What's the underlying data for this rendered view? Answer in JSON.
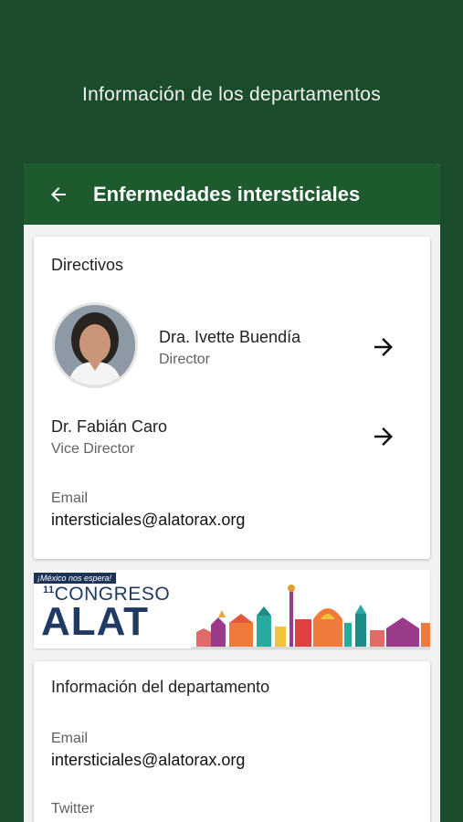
{
  "page": {
    "title": "Información de los departamentos"
  },
  "header": {
    "title": "Enfermedades intersticiales"
  },
  "directivos": {
    "title": "Directivos",
    "people": [
      {
        "name": "Dra. Ivette Buendía",
        "role": "Director"
      },
      {
        "name": "Dr. Fabián Caro",
        "role": "Vice Director"
      }
    ],
    "email_label": "Email",
    "email_value": "intersticiales@alatorax.org"
  },
  "banner": {
    "tagline": "¡México nos espera!",
    "number": "11",
    "congreso": "CONGRESO",
    "alat": "ALAT"
  },
  "department_info": {
    "title": "Información del departamento",
    "email_label": "Email",
    "email_value": "intersticiales@alatorax.org",
    "twitter_label": "Twitter"
  },
  "colors": {
    "background": "#1b4d2d",
    "header": "#1d5a2e",
    "banner_navy": "#1f3a63"
  }
}
